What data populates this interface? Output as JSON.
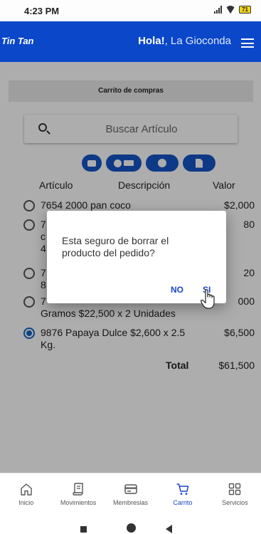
{
  "status_bar": {
    "time": "4:23 PM",
    "battery": "71"
  },
  "app_bar": {
    "brand": "Tin Tan",
    "greeting_bold": "Hola!",
    "greeting_name": ", La Gioconda"
  },
  "cart": {
    "title": "Carrito de compras"
  },
  "search": {
    "placeholder": "Buscar Artículo"
  },
  "table": {
    "headers": {
      "article": "Artículo",
      "description": "Descripción",
      "value": "Valor"
    },
    "rows": [
      {
        "desc": "7654 2000 pan coco",
        "value": "$2,000",
        "selected": false
      },
      {
        "desc": "7\nc\n4",
        "value": "80",
        "selected": false
      },
      {
        "desc": "7\n8",
        "value": "20",
        "selected": false
      },
      {
        "desc": "7\nGramos $22,500 x 2 Unidades",
        "value": "000",
        "selected": false
      },
      {
        "desc": "9876 Papaya Dulce $2,600 x 2.5 Kg.",
        "value": "$6,500",
        "selected": true
      }
    ],
    "total_label": "Total",
    "total_value": "$61,500"
  },
  "dialog": {
    "message": "Esta seguro de borrar el producto del pedido?",
    "no_label": "NO",
    "si_label": "SI"
  },
  "bottom_nav": [
    {
      "label": "Inicio",
      "icon": "home-icon",
      "active": false
    },
    {
      "label": "Movimientos",
      "icon": "receipt-icon",
      "active": false
    },
    {
      "label": "Membresias",
      "icon": "card-icon",
      "active": false
    },
    {
      "label": "Carrito",
      "icon": "cart-icon",
      "active": true
    },
    {
      "label": "Servicios",
      "icon": "grid-icon",
      "active": false
    }
  ],
  "colors": {
    "primary": "#0a47c9",
    "accent_text": "#1a46c7",
    "battery": "#f2d51a"
  }
}
